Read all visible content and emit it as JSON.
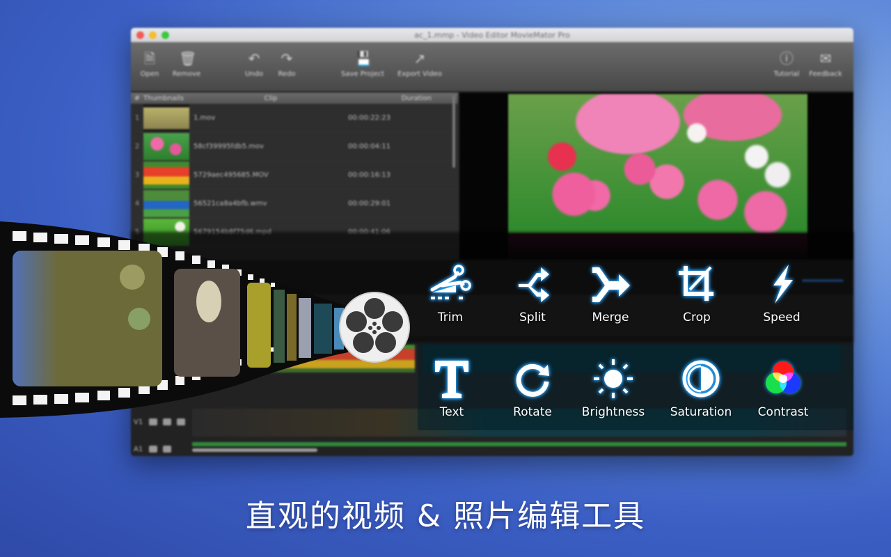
{
  "window": {
    "title": "ac_1.mmp - Video Editor MovieMator Pro"
  },
  "toolbar": {
    "open": {
      "label": "Open",
      "icon": "open-file-icon"
    },
    "remove": {
      "label": "Remove",
      "icon": "trash-icon"
    },
    "undo": {
      "label": "Undo",
      "icon": "undo-icon"
    },
    "redo": {
      "label": "Redo",
      "icon": "redo-icon"
    },
    "save_project": {
      "label": "Save Project",
      "icon": "save-icon"
    },
    "export_video": {
      "label": "Export Video",
      "icon": "export-icon"
    },
    "tutorial": {
      "label": "Tutorial",
      "icon": "help-icon"
    },
    "feedback": {
      "label": "Feedback",
      "icon": "mail-icon"
    }
  },
  "clip_list": {
    "columns": [
      "#",
      "Thumbnails",
      "Clip",
      "Duration"
    ],
    "rows": [
      {
        "num": "1",
        "clip": "1.mov",
        "duration": "00:00:22:23"
      },
      {
        "num": "2",
        "clip": "58cf39995fdb5.mov",
        "duration": "00:00:04:11"
      },
      {
        "num": "3",
        "clip": "5729aec495685.MOV",
        "duration": "00:00:16:13"
      },
      {
        "num": "4",
        "clip": "56521ca8a4bfb.wmv",
        "duration": "00:00:29:01"
      },
      {
        "num": "5",
        "clip": "5679154b8f75d6.mpd",
        "duration": "00:00:41:06"
      }
    ]
  },
  "timeline": {
    "tracks": [
      {
        "label": "V1"
      },
      {
        "label": "A1"
      }
    ]
  },
  "tools": [
    {
      "label": "Trim",
      "icon": "scissors-trim-icon"
    },
    {
      "label": "Split",
      "icon": "split-icon"
    },
    {
      "label": "Merge",
      "icon": "merge-icon"
    },
    {
      "label": "Crop",
      "icon": "crop-icon"
    },
    {
      "label": "Speed",
      "icon": "lightning-icon"
    },
    {
      "label": "Text",
      "icon": "text-t-icon"
    },
    {
      "label": "Rotate",
      "icon": "rotate-icon"
    },
    {
      "label": "Brightness",
      "icon": "sun-icon"
    },
    {
      "label": "Saturation",
      "icon": "half-circle-icon"
    },
    {
      "label": "Contrast",
      "icon": "rgb-circles-icon"
    }
  ],
  "colors": {
    "icon_glow": "#36b4ff",
    "background": "#3b5fc4",
    "timeline_green": "#2f8a3b"
  },
  "caption": "直观的视频 & 照片编辑工具"
}
